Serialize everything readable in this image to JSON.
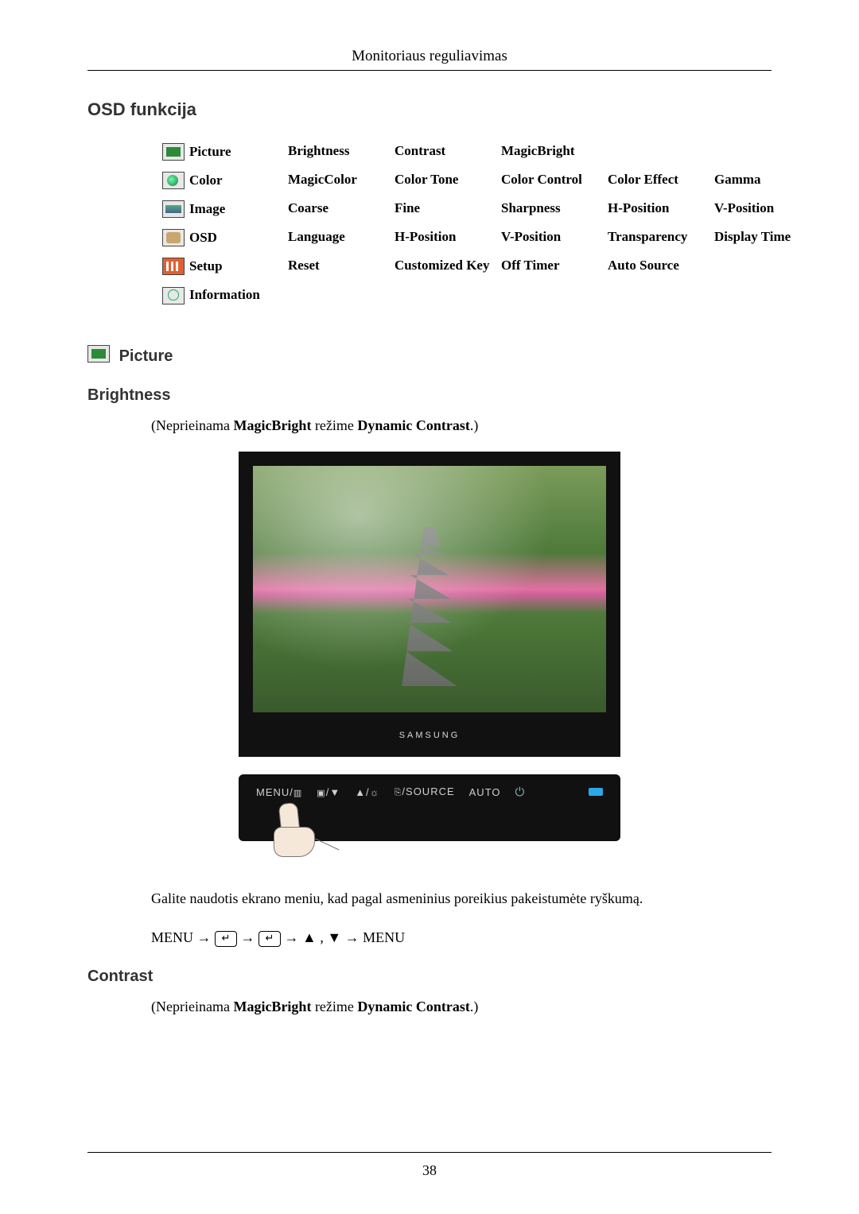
{
  "header": {
    "title": "Monitoriaus reguliavimas"
  },
  "footer": {
    "page_number": "38"
  },
  "sections": {
    "osd_heading": "OSD funkcija",
    "picture_heading": "Picture",
    "brightness_heading": "Brightness",
    "contrast_heading": "Contrast"
  },
  "osd_rows": [
    {
      "icon": "picture",
      "label": "Picture",
      "opts": [
        "Brightness",
        "Contrast",
        "MagicBright",
        "",
        ""
      ]
    },
    {
      "icon": "color",
      "label": "Color",
      "opts": [
        "MagicColor",
        "Color Tone",
        "Color Control",
        "Color Effect",
        "Gamma"
      ]
    },
    {
      "icon": "image",
      "label": "Image",
      "opts": [
        "Coarse",
        "Fine",
        "Sharpness",
        "H-Position",
        "V-Position"
      ]
    },
    {
      "icon": "osd",
      "label": "OSD",
      "opts": [
        "Language",
        "H-Position",
        "V-Position",
        "Transparency",
        "Display Time"
      ]
    },
    {
      "icon": "setup",
      "label": "Setup",
      "opts": [
        "Reset",
        "Customized Key",
        "Off Timer",
        "Auto Source",
        ""
      ]
    },
    {
      "icon": "info",
      "label": "Information",
      "opts": [
        "",
        "",
        "",
        "",
        ""
      ]
    }
  ],
  "brightness_note": {
    "pre": "(Neprieinama ",
    "b1": "MagicBright",
    "mid": " režime ",
    "b2": "Dynamic Contrast",
    "post": ".)"
  },
  "monitor": {
    "brand": "SAMSUNG",
    "buttons": {
      "menu": "MENU/",
      "enter_down": "/▼",
      "up_sun": "▲/☼",
      "source": "/SOURCE",
      "auto": "AUTO"
    }
  },
  "body_after_image": "Galite naudotis ekrano meniu, kad pagal asmeninius poreikius pakeistumėte ryškumą.",
  "menu_seq": {
    "menu": "MENU",
    "enter": "↵",
    "triangles": "▲ , ▼",
    "arrow": "→"
  },
  "contrast_note": {
    "pre": "(Neprieinama ",
    "b1": "MagicBright",
    "mid": " režime ",
    "b2": "Dynamic Contrast",
    "post": ".)"
  }
}
